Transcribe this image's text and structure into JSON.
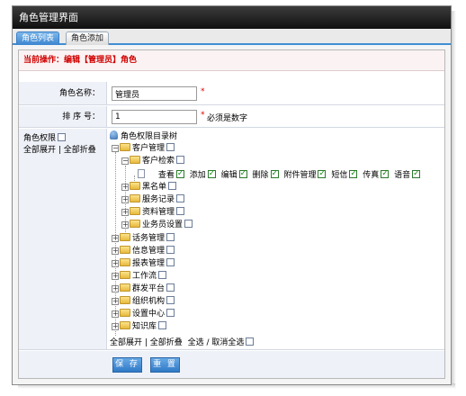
{
  "window": {
    "title": "角色管理界面"
  },
  "tabs": [
    {
      "label": "角色列表",
      "active": true
    },
    {
      "label": "角色添加",
      "active": false
    }
  ],
  "operation": {
    "text": "当前操作：编辑【管理员】角色"
  },
  "form": {
    "name_label": "角色名称：",
    "name_value": "管理员",
    "name_required": "*",
    "order_label": "排 序 号：",
    "order_value": "1",
    "order_required": "*",
    "order_hint": "必须是数字"
  },
  "permissions": {
    "label": "角色权限",
    "expand_collapse": "全部展开 | 全部折叠",
    "tree_root": "角色权限目录树",
    "tree": {
      "customer_mgmt": "客户管理",
      "customer_search": "客户检索",
      "actions": [
        "查看",
        "添加",
        "编辑",
        "删除",
        "附件管理",
        "短信",
        "传真",
        "语音"
      ],
      "blacklist": "黑名单",
      "service_record": "服务记录",
      "data_mgmt": "资料管理",
      "agent_setting": "业务员设置",
      "top_level": [
        "话务管理",
        "信息管理",
        "报表管理",
        "工作流",
        "群发平台",
        "组织机构",
        "设置中心",
        "知识库"
      ]
    },
    "footer_expand": "全部展开 | 全部折叠",
    "footer_select": "全选 / 取消全选"
  },
  "buttons": {
    "save": "保 存",
    "reset": "重 置"
  },
  "colors": {
    "title_bar": "#1a1a1a",
    "tab_active": "#3b85d0",
    "operation_text": "#d00000",
    "button": "#3a82cc",
    "required": "#e00000"
  }
}
